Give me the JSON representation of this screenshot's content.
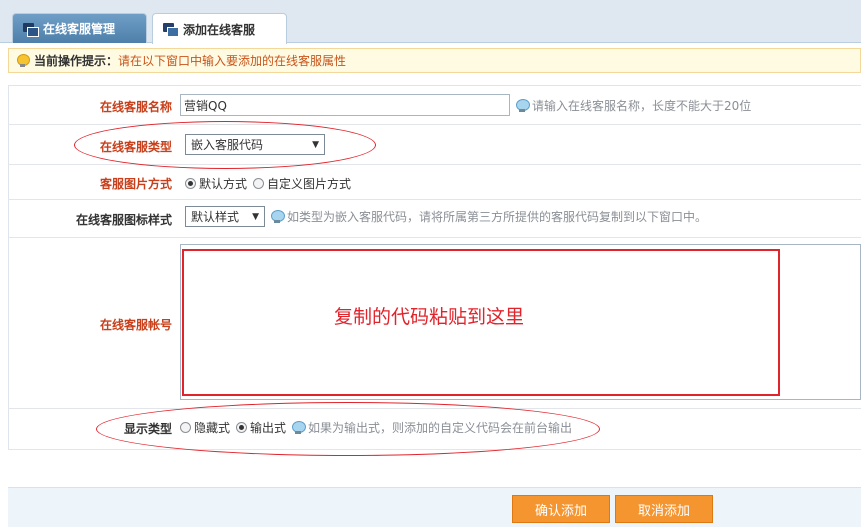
{
  "tabs": [
    {
      "label": "在线客服管理",
      "active": false
    },
    {
      "label": "添加在线客服",
      "active": true
    }
  ],
  "hint": {
    "label": "当前操作提示：",
    "text": "请在以下窗口中输入要添加的在线客服属性"
  },
  "form": {
    "name": {
      "label": "在线客服名称",
      "value": "营销QQ",
      "tip": "请输入在线客服名称，长度不能大于20位"
    },
    "type": {
      "label": "在线客服类型",
      "selected": "嵌入客服代码"
    },
    "image_mode": {
      "label": "客服图片方式",
      "options": [
        "默认方式",
        "自定义图片方式"
      ],
      "selected_index": 0
    },
    "icon_style": {
      "label": "在线客服图标样式",
      "selected": "默认样式",
      "tip": "如类型为嵌入客服代码，请将所属第三方所提供的客服代码复制到以下窗口中。"
    },
    "account": {
      "label": "在线客服帐号",
      "annotation": "复制的代码粘贴到这里"
    },
    "display_type": {
      "label": "显示类型",
      "options": [
        "隐藏式",
        "输出式"
      ],
      "selected_index": 1,
      "tip": "如果为输出式，则添加的自定义代码会在前台输出"
    }
  },
  "buttons": {
    "confirm": "确认添加",
    "cancel": "取消添加"
  },
  "colors": {
    "label_red": "#c8401b",
    "annotation_red": "#e1232b",
    "button_orange": "#f59530",
    "tab_blue": "#4e7faa"
  }
}
